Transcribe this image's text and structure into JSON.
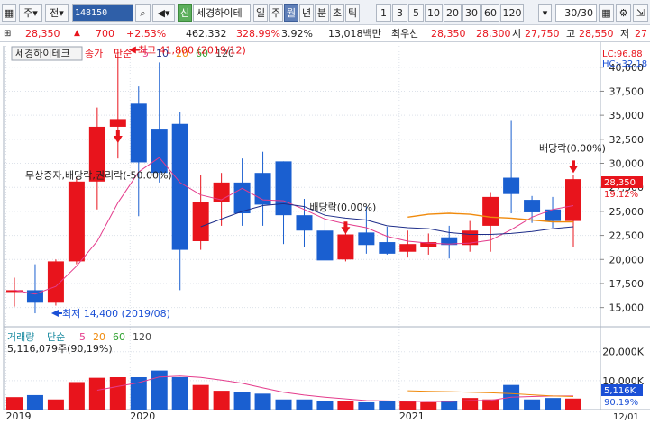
{
  "toolbar": {
    "market_type": "주",
    "sub_type": "전",
    "code": "148150",
    "stock_name": "세경하이테",
    "sin_label": "신",
    "periods": [
      "일",
      "주",
      "월",
      "년",
      "분",
      "초",
      "틱"
    ],
    "active_period": "월",
    "numbers": [
      "1",
      "3",
      "5",
      "10",
      "20",
      "30",
      "60",
      "120"
    ],
    "count": "30/30"
  },
  "infobar": {
    "price": "28,350",
    "change_arrow": "▲",
    "change": "700",
    "change_rate": "+2.53%",
    "volume": "462,332",
    "volume_ratio": "328.99%",
    "turnover": "3.92%",
    "amount": "13,018백만",
    "priority_label": "최우선",
    "ask": "28,350",
    "bid": "28,300",
    "open_label": "시",
    "open": "27,750",
    "high_label": "고",
    "high": "28,550",
    "low_label": "저",
    "low": "27"
  },
  "chart_data": {
    "type": "candlestick",
    "title_box": "세경하이테크",
    "price_legend": {
      "label": "종가",
      "ma_type": "단순",
      "periods": [
        "5",
        "10",
        "20",
        "60",
        "120"
      ],
      "colors": [
        "#e43c8c",
        "#1e2e8a",
        "#f08a0c",
        "#2ea02e",
        "#444444"
      ]
    },
    "lc_label": "LC:96.88",
    "hc_label": "HC:-32.18",
    "price_axis": {
      "ticks": [
        40000,
        37500,
        35000,
        32500,
        30000,
        27500,
        25000,
        22500,
        20000,
        17500,
        15000
      ],
      "tick_labels": [
        "40,000",
        "37,500",
        "35,000",
        "32,500",
        "30,000",
        "27,500",
        "25,000",
        "22,500",
        "20,000",
        "17,500",
        "15,000"
      ],
      "ylim": [
        13000,
        42600
      ]
    },
    "current_price_label": "28,350",
    "current_rate_label": "19.12%",
    "low_rate_label": "96.88%",
    "x_tick_labels": [
      "2019",
      "2020",
      "2021"
    ],
    "x_tick_index": [
      0,
      6,
      19
    ],
    "end_date_label": "12/01",
    "candles": [
      {
        "o": 16800,
        "h": 18100,
        "l": 15100,
        "c": 16800
      },
      {
        "o": 16800,
        "h": 19500,
        "l": 14400,
        "c": 15500
      },
      {
        "o": 15500,
        "h": 20000,
        "l": 15200,
        "c": 19800
      },
      {
        "o": 19800,
        "h": 28500,
        "l": 19500,
        "c": 28100
      },
      {
        "o": 28100,
        "h": 35800,
        "l": 25200,
        "c": 33800
      },
      {
        "o": 33800,
        "h": 41800,
        "l": 30500,
        "c": 34600
      },
      {
        "o": 36200,
        "h": 38000,
        "l": 24500,
        "c": 30100
      },
      {
        "o": 33600,
        "h": 40500,
        "l": 28000,
        "c": 29000
      },
      {
        "o": 34100,
        "h": 35300,
        "l": 16800,
        "c": 21000
      },
      {
        "o": 21900,
        "h": 28800,
        "l": 21000,
        "c": 26000
      },
      {
        "o": 26000,
        "h": 29000,
        "l": 23500,
        "c": 28000
      },
      {
        "o": 28000,
        "h": 30500,
        "l": 23500,
        "c": 24800
      },
      {
        "o": 29000,
        "h": 31200,
        "l": 23500,
        "c": 25700
      },
      {
        "o": 30200,
        "h": 30200,
        "l": 21600,
        "c": 24600
      },
      {
        "o": 24600,
        "h": 26300,
        "l": 21300,
        "c": 23000
      },
      {
        "o": 23000,
        "h": 25800,
        "l": 20200,
        "c": 19900
      },
      {
        "o": 20000,
        "h": 23000,
        "l": 19800,
        "c": 22600
      },
      {
        "o": 22800,
        "h": 25500,
        "l": 20600,
        "c": 21500
      },
      {
        "o": 21800,
        "h": 23400,
        "l": 20500,
        "c": 20600
      },
      {
        "o": 20800,
        "h": 23000,
        "l": 20200,
        "c": 21600
      },
      {
        "o": 21300,
        "h": 22700,
        "l": 20500,
        "c": 21800
      },
      {
        "o": 22300,
        "h": 23500,
        "l": 20100,
        "c": 21500
      },
      {
        "o": 21500,
        "h": 24000,
        "l": 20800,
        "c": 23000
      },
      {
        "o": 23500,
        "h": 27000,
        "l": 20800,
        "c": 26500
      },
      {
        "o": 28500,
        "h": 34500,
        "l": 24800,
        "c": 26800
      },
      {
        "o": 26200,
        "h": 26600,
        "l": 23800,
        "c": 24900
      },
      {
        "o": 25200,
        "h": 26500,
        "l": 23300,
        "c": 24000
      },
      {
        "o": 24000,
        "h": 28800,
        "l": 21300,
        "c": 28350
      }
    ],
    "ma5": [
      16800,
      16400,
      17200,
      19300,
      21900,
      25900,
      29100,
      30600,
      28000,
      26700,
      26200,
      27400,
      26200,
      26100,
      25200,
      24200,
      23700,
      23300,
      22400,
      21900,
      21700,
      21600,
      21700,
      22000,
      23100,
      24400,
      25200,
      25600
    ],
    "ma10": [
      null,
      null,
      null,
      null,
      null,
      null,
      null,
      null,
      null,
      23400,
      24200,
      25000,
      25600,
      25800,
      25500,
      24600,
      24300,
      24100,
      23500,
      23300,
      23200,
      22800,
      22600,
      22600,
      22700,
      22900,
      23200,
      23400
    ],
    "ma20": [
      null,
      null,
      null,
      null,
      null,
      null,
      null,
      null,
      null,
      null,
      null,
      null,
      null,
      null,
      null,
      null,
      null,
      null,
      null,
      24400,
      24700,
      24800,
      24700,
      24400,
      24300,
      24100,
      23900,
      23900
    ],
    "annotations": {
      "high_label": "최고 41,800 (2019/12)",
      "low_label": "최저 14,400 (2019/08)",
      "rights_label": "무상증자,배당락,권리락(-50.00%)",
      "dividend1_label": "배당락(0.00%)",
      "dividend2_label": "배당락(0.00%)"
    },
    "volume_legend": {
      "label": "거래량",
      "ma_type": "단순",
      "periods": [
        "5",
        "20",
        "60",
        "120"
      ],
      "colors": [
        "#e43c8c",
        "#f08a0c",
        "#2ea02e",
        "#444444"
      ]
    },
    "volume_info": "5,116,079주(90,19%)",
    "volume_axis": {
      "ticks": [
        20000000,
        10000000
      ],
      "tick_labels": [
        "20,000K",
        "10,000K"
      ],
      "ylim": [
        0,
        28000000
      ]
    },
    "volume_current_label": "5,116K",
    "volume_rate_label": "90.19%",
    "volume": [
      4300000,
      5000000,
      3500000,
      9500000,
      11000000,
      11200000,
      11200000,
      13500000,
      11200000,
      8500000,
      6500000,
      6000000,
      5500000,
      3500000,
      3500000,
      2800000,
      3000000,
      2500000,
      3000000,
      3000000,
      2500000,
      3000000,
      4000000,
      3500000,
      8500000,
      3500000,
      4000000,
      3800000,
      5116079
    ],
    "volume_ma5": [
      null,
      null,
      null,
      null,
      6700000,
      8000000,
      9300000,
      11300000,
      11600000,
      11100000,
      10200000,
      9100000,
      7500000,
      6000000,
      5000000,
      4300000,
      3700000,
      3100000,
      3000000,
      2900000,
      2800000,
      2800000,
      3100000,
      3200000,
      4300000,
      4500000,
      4700000,
      4700000,
      5900000
    ],
    "volume_ma20": [
      null,
      null,
      null,
      null,
      null,
      null,
      null,
      null,
      null,
      null,
      null,
      null,
      null,
      null,
      null,
      null,
      null,
      null,
      null,
      6500000,
      6300000,
      6200000,
      6000000,
      5800000,
      5500000,
      5100000,
      4700000,
      4500000,
      4400000
    ]
  }
}
